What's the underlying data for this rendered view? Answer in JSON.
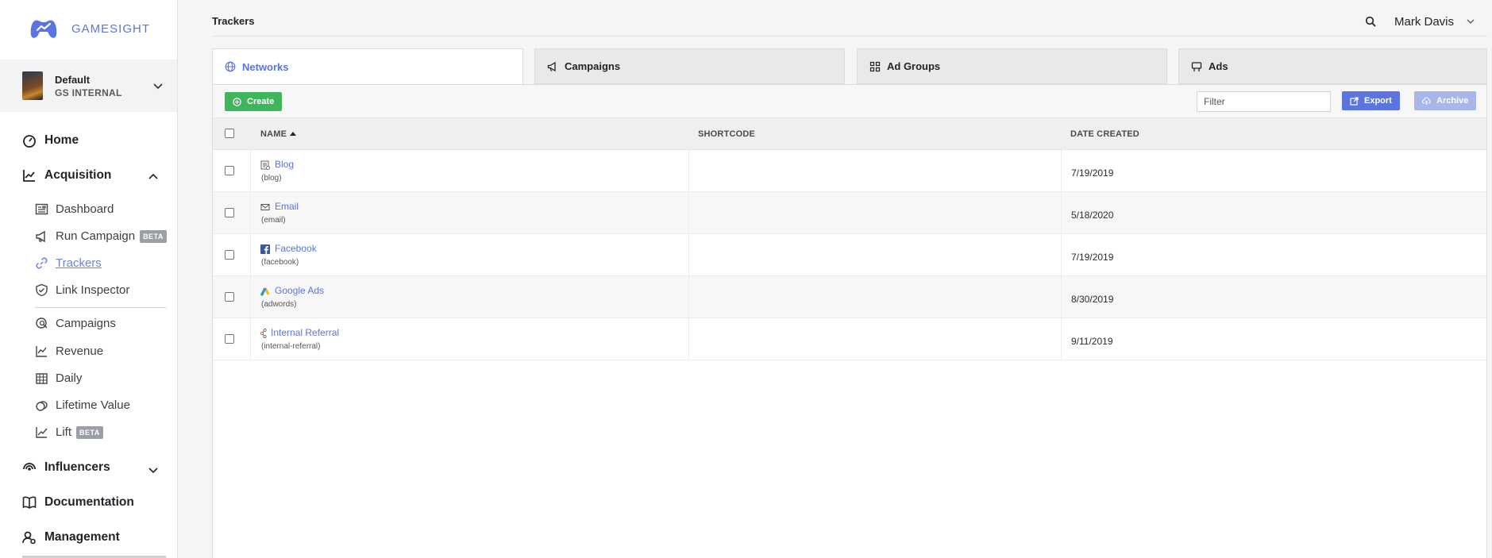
{
  "brand": {
    "name": "GAMESIGHT"
  },
  "workspace": {
    "name": "Default",
    "org": "GS INTERNAL"
  },
  "nav": {
    "home": "Home",
    "acquisition": "Acquisition",
    "acquisition_items": [
      {
        "label": "Dashboard"
      },
      {
        "label": "Run Campaign",
        "badge": "BETA"
      },
      {
        "label": "Trackers"
      },
      {
        "label": "Link Inspector"
      },
      {
        "label": "Campaigns"
      },
      {
        "label": "Revenue"
      },
      {
        "label": "Daily"
      },
      {
        "label": "Lifetime Value"
      },
      {
        "label": "Lift",
        "badge": "BETA"
      }
    ],
    "influencers": "Influencers",
    "documentation": "Documentation",
    "management": "Management"
  },
  "header": {
    "title": "Trackers",
    "user": "Mark Davis"
  },
  "tabs": [
    {
      "label": "Networks",
      "active": true
    },
    {
      "label": "Campaigns"
    },
    {
      "label": "Ad Groups"
    },
    {
      "label": "Ads"
    }
  ],
  "toolbar": {
    "create_label": "Create",
    "filter_placeholder": "Filter",
    "export_label": "Export",
    "archive_label": "Archive"
  },
  "table": {
    "columns": [
      "NAME",
      "SHORTCODE",
      "DATE CREATED"
    ],
    "rows": [
      {
        "name": "Blog",
        "code": "(blog)",
        "shortcode": "",
        "date": "7/19/2019",
        "icon": "blog-icon"
      },
      {
        "name": "Email",
        "code": "(email)",
        "shortcode": "",
        "date": "5/18/2020",
        "icon": "email-icon"
      },
      {
        "name": "Facebook",
        "code": "(facebook)",
        "shortcode": "",
        "date": "7/19/2019",
        "icon": "facebook-icon"
      },
      {
        "name": "Google Ads",
        "code": "(adwords)",
        "shortcode": "",
        "date": "8/30/2019",
        "icon": "google-ads-icon"
      },
      {
        "name": "Internal Referral",
        "code": "(internal-referral)",
        "shortcode": "",
        "date": "9/11/2019",
        "icon": "referral-icon"
      }
    ]
  },
  "colors": {
    "accent": "#5b74e0",
    "create_green": "#3fb65b",
    "archive_disabled": "#a9b6ec"
  }
}
